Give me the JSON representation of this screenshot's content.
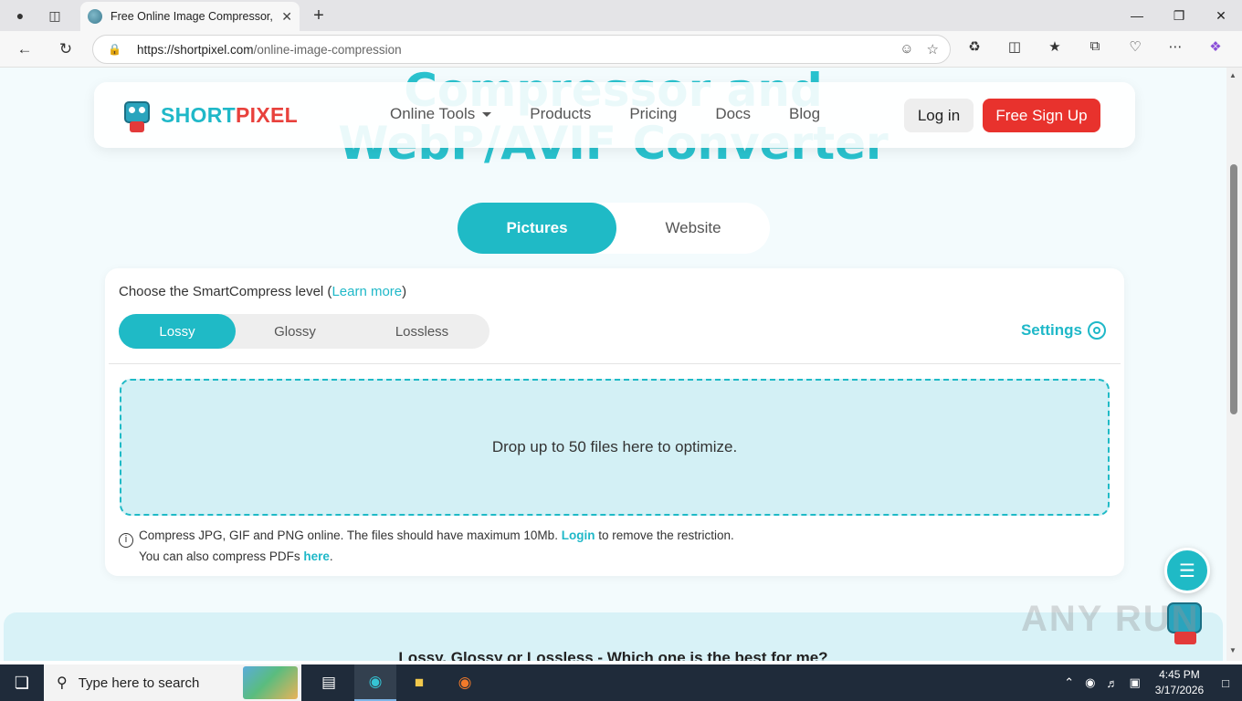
{
  "browser": {
    "tab_title": "Free Online Image Compressor, W",
    "url_domain": "https://shortpixel.com",
    "url_path": "/online-image-compression"
  },
  "hero": {
    "line1": "Compressor and",
    "line2": "WebP/AVIF Converter"
  },
  "header": {
    "logo_part1": "SHORT",
    "logo_part2": "PIXEL",
    "nav": [
      "Online Tools",
      "Products",
      "Pricing",
      "Docs",
      "Blog"
    ],
    "login_label": "Log in",
    "signup_label": "Free Sign Up"
  },
  "mode_switch": {
    "active": "Pictures",
    "inactive": "Website"
  },
  "compress_card": {
    "label_prefix": "Choose the SmartCompress level (",
    "learn_more": "Learn more",
    "label_suffix": ")",
    "levels": [
      "Lossy",
      "Glossy",
      "Lossless"
    ],
    "selected_level": "Lossy",
    "settings_label": "Settings",
    "dropzone_text": "Drop up to 50 files here to optimize.",
    "note_line1_a": "Compress JPG, GIF and PNG online. The files should have maximum 10Mb.",
    "note_login": "Login",
    "note_line1_b": "to remove the restriction.",
    "note_line2_a": "You can also compress PDFs",
    "note_here": "here",
    "note_line2_b": "."
  },
  "faq": {
    "title": "Lossy, Glossy or Lossless - Which one is the best for me?"
  },
  "watermark": "ANY RUN",
  "taskbar": {
    "search_placeholder": "Type here to search",
    "time": "4:45 PM",
    "date": "3/17/2026"
  },
  "colors": {
    "accent": "#1fbac6",
    "signup": "#e8322d",
    "dropzone_bg": "#d3f0f5"
  }
}
